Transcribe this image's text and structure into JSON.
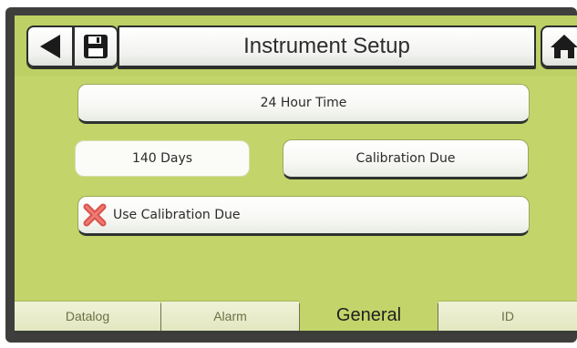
{
  "header": {
    "title": "Instrument Setup",
    "back_icon": "back-arrow-icon",
    "save_icon": "floppy-disk-icon",
    "home_icon": "home-icon"
  },
  "settings": {
    "time_format_label": "24 Hour Time",
    "calibration_interval_value": "140 Days",
    "calibration_due_label": "Calibration Due",
    "use_calibration_due_label": "Use Calibration Due",
    "use_calibration_due_icon": "x-mark-icon",
    "use_calibration_due_enabled": false
  },
  "tabs": [
    {
      "label": "Datalog",
      "active": false
    },
    {
      "label": "Alarm",
      "active": false
    },
    {
      "label": "General",
      "active": true
    },
    {
      "label": "ID",
      "active": false
    }
  ],
  "colors": {
    "screen_background": "#c3d56a",
    "button_face": "#ffffff",
    "x_mark": "#d9534f"
  }
}
